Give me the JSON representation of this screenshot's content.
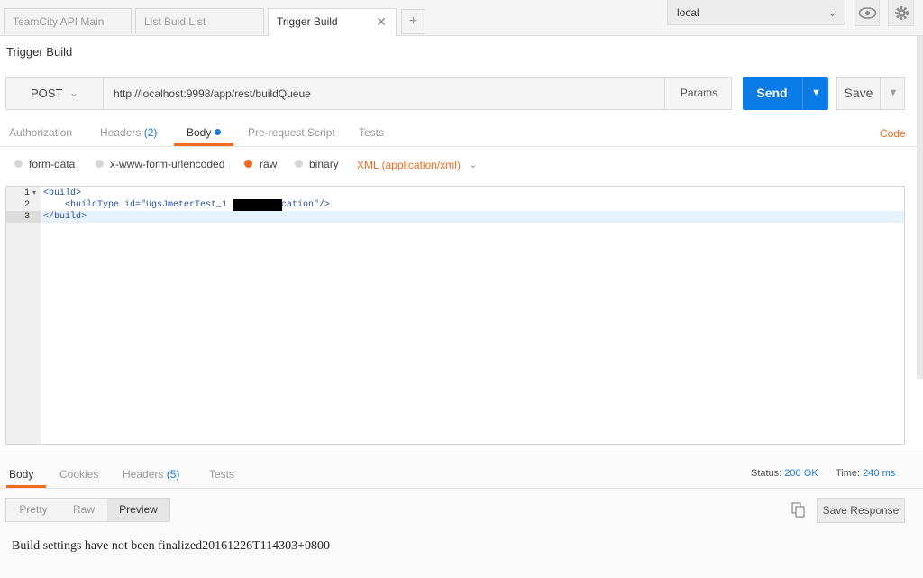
{
  "tabs": [
    {
      "label": "TeamCity API Main",
      "active": false
    },
    {
      "label": "List Buid List",
      "active": false
    },
    {
      "label": "Trigger Build",
      "active": true
    }
  ],
  "add_tab": "+",
  "environment": {
    "selected": "local"
  },
  "page_title": "Trigger Build",
  "request": {
    "method": "POST",
    "url": "http://localhost:9998/app/rest/buildQueue",
    "params_label": "Params",
    "send_label": "Send",
    "save_label": "Save"
  },
  "request_tabs": {
    "authorization": "Authorization",
    "headers": "Headers",
    "headers_count": "(2)",
    "body": "Body",
    "pre_request": "Pre-request Script",
    "tests": "Tests",
    "code": "Code"
  },
  "body_modes": {
    "form_data": "form-data",
    "urlencoded": "x-www-form-urlencoded",
    "raw": "raw",
    "binary": "binary",
    "selected": "raw",
    "content_type": "XML (application/xml)"
  },
  "editor": {
    "line_numbers": [
      "1",
      "2",
      "3"
    ],
    "lines": [
      "<build>",
      "    <buildType id=\"UgsJmeterTest_1        Location\"/>",
      "</build>"
    ]
  },
  "response_tabs": {
    "body": "Body",
    "cookies": "Cookies",
    "headers": "Headers",
    "headers_count": "(5)",
    "tests": "Tests"
  },
  "response_meta": {
    "status_label": "Status:",
    "status_value": "200 OK",
    "time_label": "Time:",
    "time_value": "240 ms"
  },
  "response_view": {
    "pretty": "Pretty",
    "raw": "Raw",
    "preview": "Preview",
    "save_response": "Save Response"
  },
  "response_text": "Build settings have not been finalized20161226T114303+0800",
  "colors": {
    "accent": "#f26b21",
    "send": "#0a7be6",
    "link": "#1f7bd6"
  }
}
